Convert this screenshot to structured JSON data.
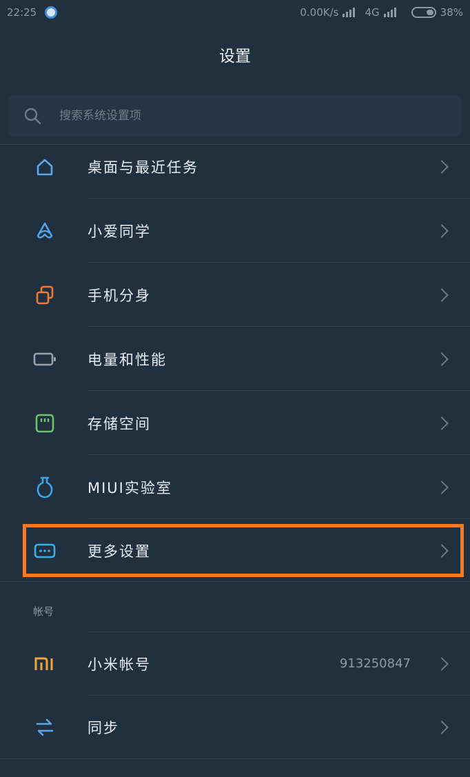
{
  "status_bar": {
    "time": "22:25",
    "network_speed": "0.00K/s",
    "network_type": "4G",
    "battery": "38%"
  },
  "header": {
    "title": "设置"
  },
  "search": {
    "placeholder": "搜索系统设置项"
  },
  "items": [
    {
      "label": "桌面与最近任务",
      "icon": "home-icon",
      "color": "#5fa6e8"
    },
    {
      "label": "小爱同学",
      "icon": "xiaoai-icon",
      "color": "#4fa8f0"
    },
    {
      "label": "手机分身",
      "icon": "second-space-icon",
      "color": "#f07a3a"
    },
    {
      "label": "电量和性能",
      "icon": "battery-icon",
      "color": "#9aa3ab"
    },
    {
      "label": "存储空间",
      "icon": "storage-icon",
      "color": "#6cc36a"
    },
    {
      "label": "MIUI实验室",
      "icon": "lab-flask-icon",
      "color": "#3aa6e6"
    },
    {
      "label": "更多设置",
      "icon": "more-settings-icon",
      "color": "#3ab0e8"
    }
  ],
  "account_section": {
    "header": "帐号",
    "items": [
      {
        "label": "小米帐号",
        "value": "913250847",
        "icon": "mi-logo-icon",
        "color": "#f0a63a"
      },
      {
        "label": "同步",
        "icon": "sync-icon",
        "color": "#5fa6e8"
      }
    ]
  },
  "highlight_color": "#f47a2a"
}
